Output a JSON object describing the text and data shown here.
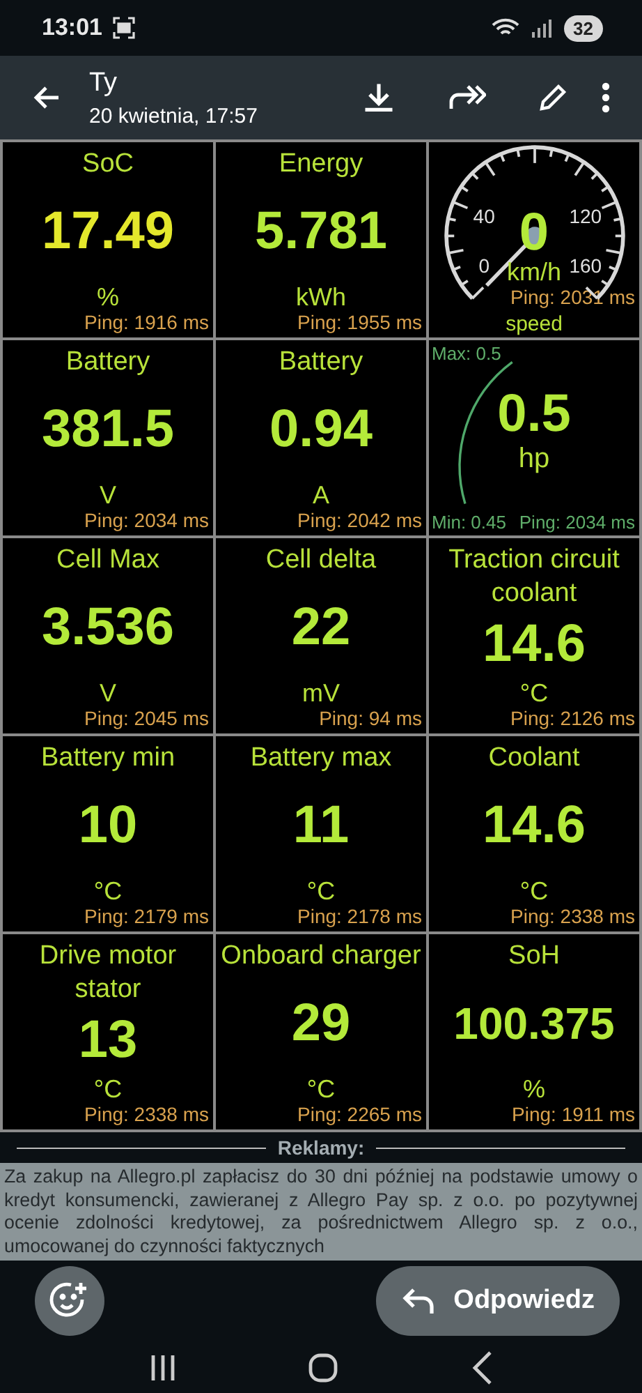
{
  "status_bar": {
    "time": "13:01",
    "battery": "32"
  },
  "viewer_header": {
    "sender": "Ty",
    "date": "20 kwietnia, 17:57"
  },
  "tiles": [
    {
      "kind": "value",
      "label": "SoC",
      "value": "17.49",
      "unit": "%",
      "ping": "Ping: 1916 ms",
      "color": "#e4e82c"
    },
    {
      "kind": "value",
      "label": "Energy",
      "value": "5.781",
      "unit": "kWh",
      "ping": "Ping: 1955 ms",
      "color": "#b4ea3a"
    },
    {
      "kind": "speed-gauge",
      "label": "speed",
      "value": "0",
      "unit": "km/h",
      "ping": "Ping: 2031 ms",
      "ticks": [
        "40",
        "120",
        "0",
        "160"
      ],
      "color": "#b4ea3a"
    },
    {
      "kind": "value",
      "label": "Battery",
      "value": "381.5",
      "unit": "V",
      "ping": "Ping: 2034 ms",
      "color": "#b4ea3a"
    },
    {
      "kind": "value",
      "label": "Battery",
      "value": "0.94",
      "unit": "A",
      "ping": "Ping: 2042 ms",
      "color": "#b4ea3a"
    },
    {
      "kind": "arc-gauge",
      "value": "0.5",
      "unit": "hp",
      "max": "Max: 0.5",
      "min": "Min: 0.45",
      "ping": "Ping: 2034 ms",
      "color": "#b4ea3a"
    },
    {
      "kind": "value",
      "label": "Cell Max",
      "value": "3.536",
      "unit": "V",
      "ping": "Ping: 2045 ms",
      "color": "#b4ea3a"
    },
    {
      "kind": "value",
      "label": "Cell delta",
      "value": "22",
      "unit": "mV",
      "ping": "Ping: 94 ms",
      "color": "#b4ea3a"
    },
    {
      "kind": "value",
      "label": "Traction circuit coolant",
      "value": "14.6",
      "unit": "°C",
      "ping": "Ping: 2126 ms",
      "color": "#b4ea3a"
    },
    {
      "kind": "value",
      "label": "Battery min",
      "value": "10",
      "unit": "°C",
      "ping": "Ping: 2179 ms",
      "color": "#b4ea3a"
    },
    {
      "kind": "value",
      "label": "Battery max",
      "value": "11",
      "unit": "°C",
      "ping": "Ping: 2178 ms",
      "color": "#b4ea3a"
    },
    {
      "kind": "value",
      "label": "Coolant",
      "value": "14.6",
      "unit": "°C",
      "ping": "Ping: 2338 ms",
      "color": "#b4ea3a"
    },
    {
      "kind": "value",
      "label": "Drive motor stator",
      "value": "13",
      "unit": "°C",
      "ping": "Ping: 2338 ms",
      "color": "#b4ea3a"
    },
    {
      "kind": "value",
      "label": "Onboard charger",
      "value": "29",
      "unit": "°C",
      "ping": "Ping: 2265 ms",
      "color": "#b4ea3a"
    },
    {
      "kind": "value",
      "label": "SoH",
      "value": "100.375",
      "unit": "%",
      "ping": "Ping: 1911 ms",
      "color": "#b4ea3a"
    }
  ],
  "ad": {
    "heading": "Reklamy:",
    "text": "Za zakup na Allegro.pl zapłacisz do 30 dni później na podstawie umowy o kredyt konsumencki, zawieranej z Allegro Pay sp. z o.o. po pozytywnej ocenie zdolności kredytowej, za pośrednictwem Allegro sp. z o.o., umocowanej do czynności faktycznych"
  },
  "reply_bar": {
    "reply": "Odpowiedz"
  }
}
